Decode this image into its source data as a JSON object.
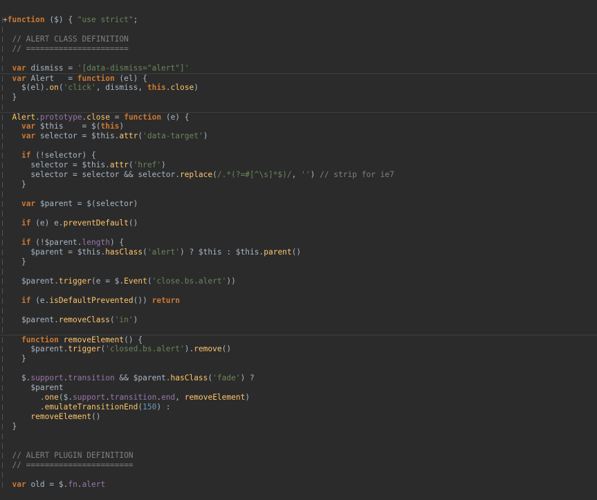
{
  "editor": {
    "language": "javascript",
    "colors": {
      "background": "#2b2b2b",
      "keyword": "#cc7832",
      "string": "#6a8759",
      "comment": "#808080",
      "number": "#6897bb",
      "property": "#9876aa",
      "function": "#ffc66d",
      "plain": "#a9b7c6"
    },
    "lines": [
      {
        "sep": false,
        "tokens": [
          [
            "plain",
            "+"
          ],
          [
            "kw",
            "function"
          ],
          [
            "plain",
            " ($) { "
          ],
          [
            "str",
            "\"use strict\""
          ],
          [
            "plain",
            ";"
          ]
        ]
      },
      {
        "sep": false,
        "tokens": []
      },
      {
        "sep": false,
        "tokens": [
          [
            "cmt",
            "  // ALERT CLASS DEFINITION"
          ]
        ]
      },
      {
        "sep": false,
        "tokens": [
          [
            "cmt",
            "  // ======================"
          ]
        ]
      },
      {
        "sep": false,
        "tokens": []
      },
      {
        "sep": false,
        "tokens": [
          [
            "plain",
            "  "
          ],
          [
            "kw",
            "var"
          ],
          [
            "plain",
            " dismiss = "
          ],
          [
            "str",
            "'[data-dismiss=\"alert\"]'"
          ]
        ]
      },
      {
        "sep": true,
        "tokens": [
          [
            "plain",
            "  "
          ],
          [
            "kw",
            "var"
          ],
          [
            "plain",
            " Alert   = "
          ],
          [
            "kw",
            "function"
          ],
          [
            "plain",
            " (el) {"
          ]
        ]
      },
      {
        "sep": false,
        "tokens": [
          [
            "plain",
            "    $(el)."
          ],
          [
            "fn",
            "on"
          ],
          [
            "plain",
            "("
          ],
          [
            "str",
            "'click'"
          ],
          [
            "plain",
            ", dismiss, "
          ],
          [
            "kw",
            "this"
          ],
          [
            "plain",
            "."
          ],
          [
            "fn",
            "close"
          ],
          [
            "plain",
            ")"
          ]
        ]
      },
      {
        "sep": false,
        "tokens": [
          [
            "plain",
            "  }"
          ]
        ]
      },
      {
        "sep": false,
        "tokens": []
      },
      {
        "sep": true,
        "tokens": [
          [
            "plain",
            "  "
          ],
          [
            "fn",
            "Alert"
          ],
          [
            "plain",
            "."
          ],
          [
            "prop",
            "prototype"
          ],
          [
            "plain",
            "."
          ],
          [
            "fn",
            "close"
          ],
          [
            "plain",
            " = "
          ],
          [
            "kw",
            "function"
          ],
          [
            "plain",
            " (e) {"
          ]
        ]
      },
      {
        "sep": false,
        "tokens": [
          [
            "plain",
            "    "
          ],
          [
            "kw",
            "var"
          ],
          [
            "plain",
            " $this    = $("
          ],
          [
            "kw",
            "this"
          ],
          [
            "plain",
            ")"
          ]
        ]
      },
      {
        "sep": false,
        "tokens": [
          [
            "plain",
            "    "
          ],
          [
            "kw",
            "var"
          ],
          [
            "plain",
            " selector = $this."
          ],
          [
            "fn",
            "attr"
          ],
          [
            "plain",
            "("
          ],
          [
            "str",
            "'data-target'"
          ],
          [
            "plain",
            ")"
          ]
        ]
      },
      {
        "sep": false,
        "tokens": []
      },
      {
        "sep": false,
        "tokens": [
          [
            "plain",
            "    "
          ],
          [
            "kw",
            "if"
          ],
          [
            "plain",
            " (!selector) {"
          ]
        ]
      },
      {
        "sep": false,
        "tokens": [
          [
            "plain",
            "      selector = $this."
          ],
          [
            "fn",
            "attr"
          ],
          [
            "plain",
            "("
          ],
          [
            "str",
            "'href'"
          ],
          [
            "plain",
            ")"
          ]
        ]
      },
      {
        "sep": false,
        "tokens": [
          [
            "plain",
            "      selector = selector && selector."
          ],
          [
            "fn",
            "replace"
          ],
          [
            "plain",
            "("
          ],
          [
            "str",
            "/.*(?=#[^\\s]*$)/"
          ],
          [
            "plain",
            ", "
          ],
          [
            "str",
            "''"
          ],
          [
            "plain",
            ") "
          ],
          [
            "cmt",
            "// strip for ie7"
          ]
        ]
      },
      {
        "sep": false,
        "tokens": [
          [
            "plain",
            "    }"
          ]
        ]
      },
      {
        "sep": false,
        "tokens": []
      },
      {
        "sep": false,
        "tokens": [
          [
            "plain",
            "    "
          ],
          [
            "kw",
            "var"
          ],
          [
            "plain",
            " $parent = $(selector)"
          ]
        ]
      },
      {
        "sep": false,
        "tokens": []
      },
      {
        "sep": false,
        "tokens": [
          [
            "plain",
            "    "
          ],
          [
            "kw",
            "if"
          ],
          [
            "plain",
            " (e) e."
          ],
          [
            "fn",
            "preventDefault"
          ],
          [
            "plain",
            "()"
          ]
        ]
      },
      {
        "sep": false,
        "tokens": []
      },
      {
        "sep": false,
        "tokens": [
          [
            "plain",
            "    "
          ],
          [
            "kw",
            "if"
          ],
          [
            "plain",
            " (!$parent."
          ],
          [
            "prop",
            "length"
          ],
          [
            "plain",
            ") {"
          ]
        ]
      },
      {
        "sep": false,
        "tokens": [
          [
            "plain",
            "      $parent = $this."
          ],
          [
            "fn",
            "hasClass"
          ],
          [
            "plain",
            "("
          ],
          [
            "str",
            "'alert'"
          ],
          [
            "plain",
            ") ? $this : $this."
          ],
          [
            "fn",
            "parent"
          ],
          [
            "plain",
            "()"
          ]
        ]
      },
      {
        "sep": false,
        "tokens": [
          [
            "plain",
            "    }"
          ]
        ]
      },
      {
        "sep": false,
        "tokens": []
      },
      {
        "sep": false,
        "tokens": [
          [
            "plain",
            "    $parent."
          ],
          [
            "fn",
            "trigger"
          ],
          [
            "plain",
            "(e = $."
          ],
          [
            "fn",
            "Event"
          ],
          [
            "plain",
            "("
          ],
          [
            "str",
            "'close.bs.alert'"
          ],
          [
            "plain",
            "))"
          ]
        ]
      },
      {
        "sep": false,
        "tokens": []
      },
      {
        "sep": false,
        "tokens": [
          [
            "plain",
            "    "
          ],
          [
            "kw",
            "if"
          ],
          [
            "plain",
            " (e."
          ],
          [
            "fn",
            "isDefaultPrevented"
          ],
          [
            "plain",
            "()) "
          ],
          [
            "kw",
            "return"
          ]
        ]
      },
      {
        "sep": false,
        "tokens": []
      },
      {
        "sep": false,
        "tokens": [
          [
            "plain",
            "    $parent."
          ],
          [
            "fn",
            "removeClass"
          ],
          [
            "plain",
            "("
          ],
          [
            "str",
            "'in'"
          ],
          [
            "plain",
            ")"
          ]
        ]
      },
      {
        "sep": false,
        "tokens": []
      },
      {
        "sep": true,
        "tokens": [
          [
            "plain",
            "    "
          ],
          [
            "kw",
            "function"
          ],
          [
            "plain",
            " "
          ],
          [
            "fn",
            "removeElement"
          ],
          [
            "plain",
            "() {"
          ]
        ]
      },
      {
        "sep": false,
        "tokens": [
          [
            "plain",
            "      $parent."
          ],
          [
            "fn",
            "trigger"
          ],
          [
            "plain",
            "("
          ],
          [
            "str",
            "'closed.bs.alert'"
          ],
          [
            "plain",
            ")."
          ],
          [
            "fn",
            "remove"
          ],
          [
            "plain",
            "()"
          ]
        ]
      },
      {
        "sep": false,
        "tokens": [
          [
            "plain",
            "    }"
          ]
        ]
      },
      {
        "sep": false,
        "tokens": []
      },
      {
        "sep": false,
        "tokens": [
          [
            "plain",
            "    $."
          ],
          [
            "prop",
            "support"
          ],
          [
            "plain",
            "."
          ],
          [
            "prop",
            "transition"
          ],
          [
            "plain",
            " && $parent."
          ],
          [
            "fn",
            "hasClass"
          ],
          [
            "plain",
            "("
          ],
          [
            "str",
            "'fade'"
          ],
          [
            "plain",
            ") ?"
          ]
        ]
      },
      {
        "sep": false,
        "tokens": [
          [
            "plain",
            "      $parent"
          ]
        ]
      },
      {
        "sep": false,
        "tokens": [
          [
            "plain",
            "        ."
          ],
          [
            "fn",
            "one"
          ],
          [
            "plain",
            "($."
          ],
          [
            "prop",
            "support"
          ],
          [
            "plain",
            "."
          ],
          [
            "prop",
            "transition"
          ],
          [
            "plain",
            "."
          ],
          [
            "prop",
            "end"
          ],
          [
            "plain",
            ", "
          ],
          [
            "fn",
            "removeElement"
          ],
          [
            "plain",
            ")"
          ]
        ]
      },
      {
        "sep": false,
        "tokens": [
          [
            "plain",
            "        ."
          ],
          [
            "fn",
            "emulateTransitionEnd"
          ],
          [
            "plain",
            "("
          ],
          [
            "num",
            "150"
          ],
          [
            "plain",
            ") :"
          ]
        ]
      },
      {
        "sep": false,
        "tokens": [
          [
            "plain",
            "      "
          ],
          [
            "fn",
            "removeElement"
          ],
          [
            "plain",
            "()"
          ]
        ]
      },
      {
        "sep": false,
        "tokens": [
          [
            "plain",
            "  }"
          ]
        ]
      },
      {
        "sep": false,
        "tokens": []
      },
      {
        "sep": false,
        "tokens": []
      },
      {
        "sep": false,
        "tokens": [
          [
            "cmt",
            "  // ALERT PLUGIN DEFINITION"
          ]
        ]
      },
      {
        "sep": false,
        "tokens": [
          [
            "cmt",
            "  // ======================="
          ]
        ]
      },
      {
        "sep": false,
        "tokens": []
      },
      {
        "sep": false,
        "tokens": [
          [
            "plain",
            "  "
          ],
          [
            "kw",
            "var"
          ],
          [
            "plain",
            " old = $."
          ],
          [
            "prop",
            "fn"
          ],
          [
            "plain",
            "."
          ],
          [
            "prop",
            "alert"
          ]
        ]
      }
    ]
  }
}
